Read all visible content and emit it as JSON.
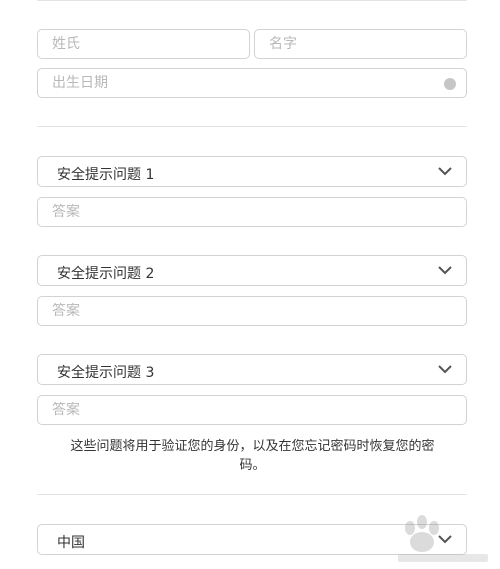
{
  "name": {
    "last_placeholder": "姓氏",
    "first_placeholder": "名字"
  },
  "birthday": {
    "placeholder": "出生日期",
    "info_icon": "info-icon"
  },
  "security": {
    "questions": [
      {
        "label": "安全提示问题 1",
        "answer_placeholder": "答案"
      },
      {
        "label": "安全提示问题 2",
        "answer_placeholder": "答案"
      },
      {
        "label": "安全提示问题 3",
        "answer_placeholder": "答案"
      }
    ],
    "note": "这些问题将用于验证您的身份，以及在您忘记密码时恢复您的密码。"
  },
  "country": {
    "selected": "中国"
  },
  "colors": {
    "border": "#d2d2d7",
    "text": "#333333",
    "placeholder": "#b8b8b8"
  }
}
